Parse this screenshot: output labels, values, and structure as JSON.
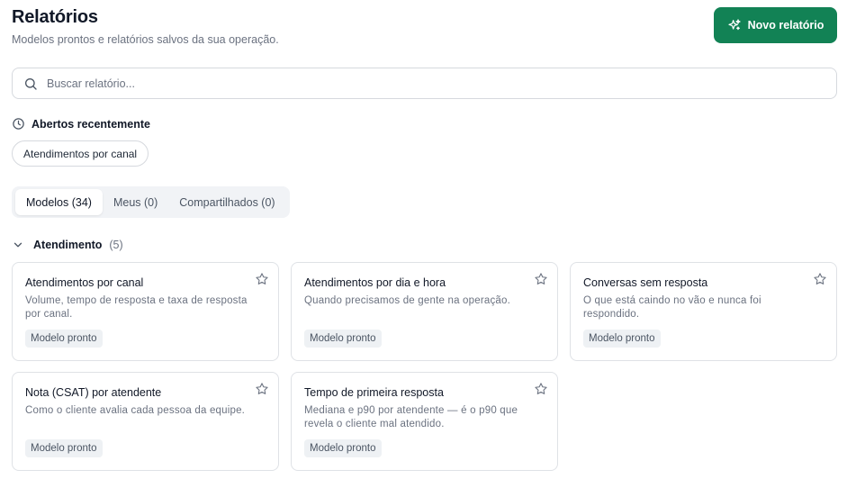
{
  "header": {
    "title": "Relatórios",
    "subtitle": "Modelos prontos e relatórios salvos da sua operação.",
    "new_button_label": "Novo relatório",
    "new_button_icon": "sparkles-icon"
  },
  "search": {
    "placeholder": "Buscar relatório...",
    "value": "",
    "icon": "search-icon"
  },
  "recent": {
    "heading": "Abertos recentemente",
    "icon": "clock-icon",
    "items": [
      "Atendimentos por canal"
    ]
  },
  "tabs": [
    {
      "label": "Modelos (34)",
      "active": true
    },
    {
      "label": "Meus (0)",
      "active": false
    },
    {
      "label": "Compartilhados (0)",
      "active": false
    }
  ],
  "group": {
    "name": "Atendimento",
    "count": "(5)",
    "expanded": true
  },
  "cards": [
    {
      "title": "Atendimentos por canal",
      "description": "Volume, tempo de resposta e taxa de resposta por canal.",
      "badge": "Modelo pronto"
    },
    {
      "title": "Atendimentos por dia e hora",
      "description": "Quando precisamos de gente na operação.",
      "badge": "Modelo pronto"
    },
    {
      "title": "Conversas sem resposta",
      "description": "O que está caindo no vão e nunca foi respondido.",
      "badge": "Modelo pronto"
    },
    {
      "title": "Nota (CSAT) por atendente",
      "description": "Como o cliente avalia cada pessoa da equipe.",
      "badge": "Modelo pronto"
    },
    {
      "title": "Tempo de primeira resposta",
      "description": "Mediana e p90 por atendente — é o p90 que revela o cliente mal atendido.",
      "badge": "Modelo pronto"
    }
  ],
  "colors": {
    "accent": "#128255",
    "border": "#dfe2e6",
    "muted_text": "#6b7280"
  }
}
